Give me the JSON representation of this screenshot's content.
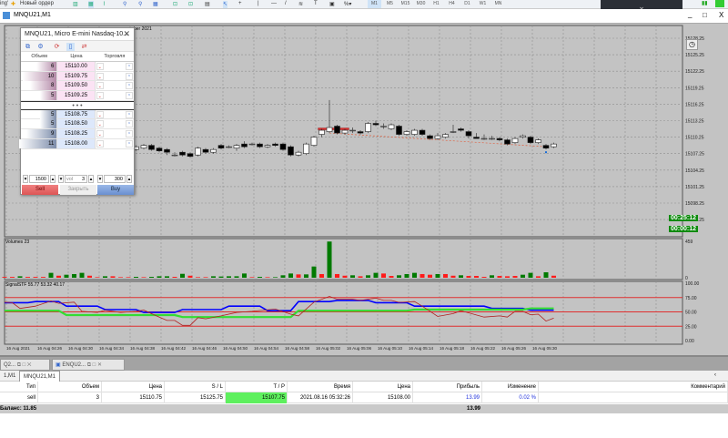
{
  "toolbar": {
    "left_partial": "ing'",
    "new_order": "Новый ордер",
    "timeframes": [
      "M1",
      "M5",
      "M15",
      "M30",
      "H1",
      "H4",
      "D1",
      "W1",
      "MN"
    ],
    "active_timeframe": "M1"
  },
  "window": {
    "title": "MNQU21,M1",
    "minimize": "_",
    "maximize": "□",
    "close": "X"
  },
  "chart": {
    "date_header": "ber 2021",
    "price_axis": [
      "15128.25",
      "15125.25",
      "15122.25",
      "15119.25",
      "15116.25",
      "15113.25",
      "15110.25",
      "15107.25",
      "15104.25",
      "15101.25",
      "15098.25",
      "15095.25"
    ],
    "timers": [
      "00:25:12",
      "00:00:12"
    ],
    "volumes_label": "Volumes 23",
    "volume_axis": [
      "459",
      "0"
    ],
    "signal_label": "SignalSTF 55.77 53.32 40.17",
    "signal_axis": [
      "100.00",
      "75.00",
      "50.00",
      "25.00",
      "0.00"
    ],
    "time_axis": [
      "16 Aug 2021",
      "16 Aug 04:26",
      "16 Aug 04:30",
      "16 Aug 04:34",
      "16 Aug 04:38",
      "16 Aug 04:42",
      "16 Aug 04:46",
      "16 Aug 04:50",
      "16 Aug 04:54",
      "16 Aug 04:58",
      "16 Aug 05:02",
      "16 Aug 05:06",
      "16 Aug 05:10",
      "16 Aug 05:14",
      "16 Aug 05:18",
      "16 Aug 05:22",
      "16 Aug 05:26",
      "16 Aug 05:30"
    ],
    "colors": {
      "bg": "#c3c3c3",
      "grid": "#8f8f8f",
      "up": "#ffffff",
      "down": "#000000",
      "vol_up": "#007a00",
      "vol_down": "#ff1a1a",
      "blue": "#0000ff",
      "green": "#33dd33",
      "red_line": "#b02020",
      "level": "#e03030",
      "timer_bg": "#0b8a0b"
    }
  },
  "chart_data": {
    "type": "candlestick",
    "price_range": [
      15095.25,
      15128.25
    ],
    "candles_first_time": "04:39",
    "candles": [
      [
        15108.0,
        15108.75,
        15107.75,
        15108.5
      ],
      [
        15108.25,
        15109.0,
        15108.0,
        15108.75
      ],
      [
        15108.75,
        15109.0,
        15107.75,
        15108.0
      ],
      [
        15108.25,
        15108.5,
        15107.5,
        15107.75
      ],
      [
        15108.0,
        15108.25,
        15107.0,
        15107.5
      ],
      [
        15107.0,
        15107.5,
        15106.75,
        15107.0
      ],
      [
        15107.5,
        15107.75,
        15106.75,
        15107.0
      ],
      [
        15107.25,
        15107.5,
        15106.5,
        15106.75
      ],
      [
        15107.0,
        15108.5,
        15106.75,
        15108.25
      ],
      [
        15108.0,
        15108.25,
        15107.25,
        15107.5
      ],
      [
        15107.5,
        15108.25,
        15107.25,
        15108.0
      ],
      [
        15108.75,
        15109.0,
        15108.0,
        15108.25
      ],
      [
        15108.5,
        15108.75,
        15108.25,
        15108.5
      ],
      [
        15108.25,
        15109.0,
        15107.75,
        15108.75
      ],
      [
        15109.0,
        15109.5,
        15108.25,
        15108.5
      ],
      [
        15109.0,
        15109.25,
        15108.75,
        15109.0
      ],
      [
        15109.0,
        15109.25,
        15108.25,
        15108.5
      ],
      [
        15108.5,
        15109.0,
        15108.25,
        15108.75
      ],
      [
        15109.0,
        15109.25,
        15108.5,
        15108.75
      ],
      [
        15109.0,
        15109.25,
        15107.75,
        15108.0
      ],
      [
        15108.5,
        15108.75,
        15106.75,
        15107.0
      ],
      [
        15107.0,
        15107.75,
        15106.75,
        15107.5
      ],
      [
        15107.25,
        15109.25,
        15107.0,
        15109.0
      ],
      [
        15108.75,
        15110.5,
        15108.5,
        15110.25
      ],
      [
        15110.75,
        15111.75,
        15110.25,
        15111.5
      ],
      [
        15111.25,
        15117.0,
        15111.0,
        15112.0
      ],
      [
        15112.25,
        15112.5,
        15110.75,
        15111.0
      ],
      [
        15111.0,
        15111.75,
        15110.75,
        15111.5
      ],
      [
        15111.5,
        15112.0,
        15111.0,
        15111.5
      ],
      [
        15111.25,
        15111.5,
        15110.75,
        15111.0
      ],
      [
        15111.25,
        15113.0,
        15111.0,
        15112.75
      ],
      [
        15112.75,
        15113.25,
        15112.25,
        15112.5
      ],
      [
        15112.25,
        15112.75,
        15111.75,
        15112.25
      ],
      [
        15111.75,
        15112.75,
        15111.5,
        15112.5
      ],
      [
        15112.25,
        15112.5,
        15110.5,
        15110.75
      ],
      [
        15110.75,
        15111.5,
        15110.5,
        15111.25
      ],
      [
        15110.75,
        15111.75,
        15110.5,
        15111.5
      ],
      [
        15111.5,
        15111.75,
        15110.5,
        15110.75
      ],
      [
        15110.5,
        15110.75,
        15109.75,
        15110.0
      ],
      [
        15110.0,
        15111.0,
        15109.75,
        15110.5
      ],
      [
        15110.25,
        15111.0,
        15110.0,
        15110.75
      ],
      [
        15111.25,
        15112.5,
        15111.0,
        15111.25
      ],
      [
        15111.75,
        15112.0,
        15111.25,
        15111.5
      ],
      [
        15111.25,
        15111.5,
        15110.0,
        15110.5
      ],
      [
        15110.25,
        15111.0,
        15110.0,
        15110.0
      ],
      [
        15110.0,
        15110.75,
        15109.75,
        15110.0
      ],
      [
        15110.0,
        15110.5,
        15109.75,
        15110.0
      ],
      [
        15110.0,
        15110.25,
        15109.5,
        15109.75
      ],
      [
        15109.75,
        15110.0,
        15108.75,
        15109.0
      ],
      [
        15109.25,
        15110.25,
        15109.0,
        15110.0
      ],
      [
        15110.25,
        15110.75,
        15110.0,
        15110.5
      ],
      [
        15110.25,
        15110.5,
        15109.0,
        15109.25
      ],
      [
        15109.25,
        15110.0,
        15109.0,
        15109.75
      ],
      [
        15108.75,
        15109.0,
        15108.0,
        15108.25
      ],
      [
        15108.5,
        15109.25,
        15108.25,
        15109.0
      ]
    ],
    "position_level": 15111.75,
    "volume_first_time": "04:22",
    "volume_range": [
      0,
      459
    ],
    "volumes": [
      10,
      10,
      18,
      10,
      10,
      10,
      60,
      25,
      37,
      45,
      60,
      25,
      7,
      18,
      18,
      7,
      7,
      11,
      7,
      11,
      18,
      18,
      11,
      48,
      25,
      7,
      7,
      18,
      15,
      18,
      18,
      52,
      7,
      11,
      7,
      7,
      30,
      52,
      41,
      41,
      138,
      45,
      445,
      45,
      25,
      30,
      18,
      30,
      60,
      52,
      22,
      30,
      45,
      60,
      45,
      37,
      45,
      45,
      25,
      30,
      22,
      22,
      11,
      30,
      22,
      18,
      22,
      37,
      60,
      18,
      67,
      25
    ],
    "volume_dirs": "rrgrrrgrgggrrgrrrgrgggrgrrrgggggrgrgggrggrgrrgrggrrgggrrgrrgrrrgrrrggrgr",
    "signal_range": [
      0,
      100
    ],
    "signal_levels": [
      75,
      50,
      25
    ],
    "signal_series": [
      {
        "color": "blue",
        "points": [
          [
            "04:22",
            66
          ],
          [
            "04:25",
            66
          ],
          [
            "04:26",
            68
          ],
          [
            "04:29",
            68
          ],
          [
            "04:30",
            60
          ],
          [
            "04:34",
            60
          ],
          [
            "04:35",
            54
          ],
          [
            "04:39",
            54
          ],
          [
            "04:40",
            49
          ],
          [
            "04:44",
            49
          ],
          [
            "04:45",
            54
          ],
          [
            "04:50",
            54
          ],
          [
            "04:51",
            60
          ],
          [
            "04:55",
            60
          ],
          [
            "04:56",
            52
          ],
          [
            "04:59",
            52
          ],
          [
            "05:00",
            68
          ],
          [
            "05:04",
            68
          ],
          [
            "05:05",
            70
          ],
          [
            "05:09",
            70
          ],
          [
            "05:10",
            66
          ],
          [
            "05:14",
            66
          ],
          [
            "05:15",
            60
          ],
          [
            "05:24",
            60
          ],
          [
            "05:25",
            56
          ],
          [
            "05:29",
            56
          ],
          [
            "05:30",
            53
          ],
          [
            "05:33",
            53
          ]
        ]
      },
      {
        "color": "green",
        "points": [
          [
            "04:22",
            52
          ],
          [
            "04:29",
            52
          ],
          [
            "04:30",
            44.5
          ],
          [
            "04:44",
            44.5
          ],
          [
            "04:45",
            41
          ],
          [
            "04:59",
            41
          ],
          [
            "05:00",
            52
          ],
          [
            "05:14",
            52
          ],
          [
            "05:15",
            54
          ],
          [
            "05:29",
            54
          ],
          [
            "05:30",
            56
          ],
          [
            "05:33",
            56
          ]
        ]
      },
      {
        "color": "red",
        "points": [
          [
            "04:22",
            67
          ],
          [
            "04:23",
            66
          ],
          [
            "04:24",
            56
          ],
          [
            "04:26",
            60
          ],
          [
            "04:28",
            69
          ],
          [
            "04:29",
            65
          ],
          [
            "04:31",
            67
          ],
          [
            "04:32",
            51
          ],
          [
            "04:34",
            49
          ],
          [
            "04:35",
            53
          ],
          [
            "04:37",
            49
          ],
          [
            "04:39",
            51
          ],
          [
            "04:40",
            53
          ],
          [
            "04:42",
            41
          ],
          [
            "04:43",
            35
          ],
          [
            "04:44",
            35
          ],
          [
            "04:45",
            26.5
          ],
          [
            "04:46",
            26.5
          ],
          [
            "04:47",
            40
          ],
          [
            "04:48",
            38
          ],
          [
            "04:50",
            43
          ],
          [
            "04:52",
            49
          ],
          [
            "04:54",
            51
          ],
          [
            "04:57",
            55
          ],
          [
            "04:59",
            46
          ],
          [
            "05:00",
            43
          ],
          [
            "05:02",
            67
          ],
          [
            "05:04",
            77
          ],
          [
            "05:05",
            72
          ],
          [
            "05:07",
            72
          ],
          [
            "05:08",
            70
          ],
          [
            "05:10",
            74
          ],
          [
            "05:11",
            70
          ],
          [
            "05:12",
            70
          ],
          [
            "05:13",
            66.5
          ],
          [
            "05:15",
            68
          ],
          [
            "05:16",
            60
          ],
          [
            "05:18",
            42
          ],
          [
            "05:20",
            47
          ],
          [
            "05:21",
            52
          ],
          [
            "05:24",
            41
          ],
          [
            "05:26",
            43
          ],
          [
            "05:27",
            41
          ],
          [
            "05:28",
            51
          ],
          [
            "05:29",
            51
          ],
          [
            "05:30",
            45
          ],
          [
            "05:31",
            46
          ],
          [
            "05:32",
            34
          ],
          [
            "05:33",
            39
          ]
        ]
      }
    ]
  },
  "dom": {
    "title": "MNQU21, Micro E-mini Nasdaq-10...",
    "headers": [
      "Объем",
      "Цена",
      "Торговля"
    ],
    "asks": [
      {
        "vol": "6",
        "price": "15110.00"
      },
      {
        "vol": "10",
        "price": "15109.75"
      },
      {
        "vol": "8",
        "price": "15109.50"
      },
      {
        "vol": "5",
        "price": "15109.25"
      }
    ],
    "separator": "• • •",
    "bids": [
      {
        "vol": "5",
        "price": "15108.75"
      },
      {
        "vol": "5",
        "price": "15108.50"
      },
      {
        "vol": "9",
        "price": "15108.25"
      },
      {
        "vol": "11",
        "price": "15108.00"
      }
    ],
    "controls": {
      "left_value": "1500",
      "vol_label": "vol",
      "vol_value": "3",
      "right_value": "300"
    },
    "sell": "Sell",
    "close": "Закрыть",
    "buy": "Buy"
  },
  "bottom": {
    "minimized": [
      "Q2...",
      "ENQU2..."
    ],
    "tabs": [
      "1,M1",
      "MNQU21,M1"
    ],
    "columns": [
      "Тип",
      "Объем",
      "Цена",
      "S / L",
      "T / P",
      "Время",
      "Цена",
      "Прибыль",
      "Изменение",
      "Комментарий"
    ],
    "row": [
      "sell",
      "3",
      "15110.75",
      "15125.75",
      "15107.75",
      "2021.08.16 05:32:26",
      "15108.00",
      "13.99",
      "0.02 %",
      ""
    ],
    "balance": "Баланс: 11.85",
    "total_profit": "13.99"
  }
}
